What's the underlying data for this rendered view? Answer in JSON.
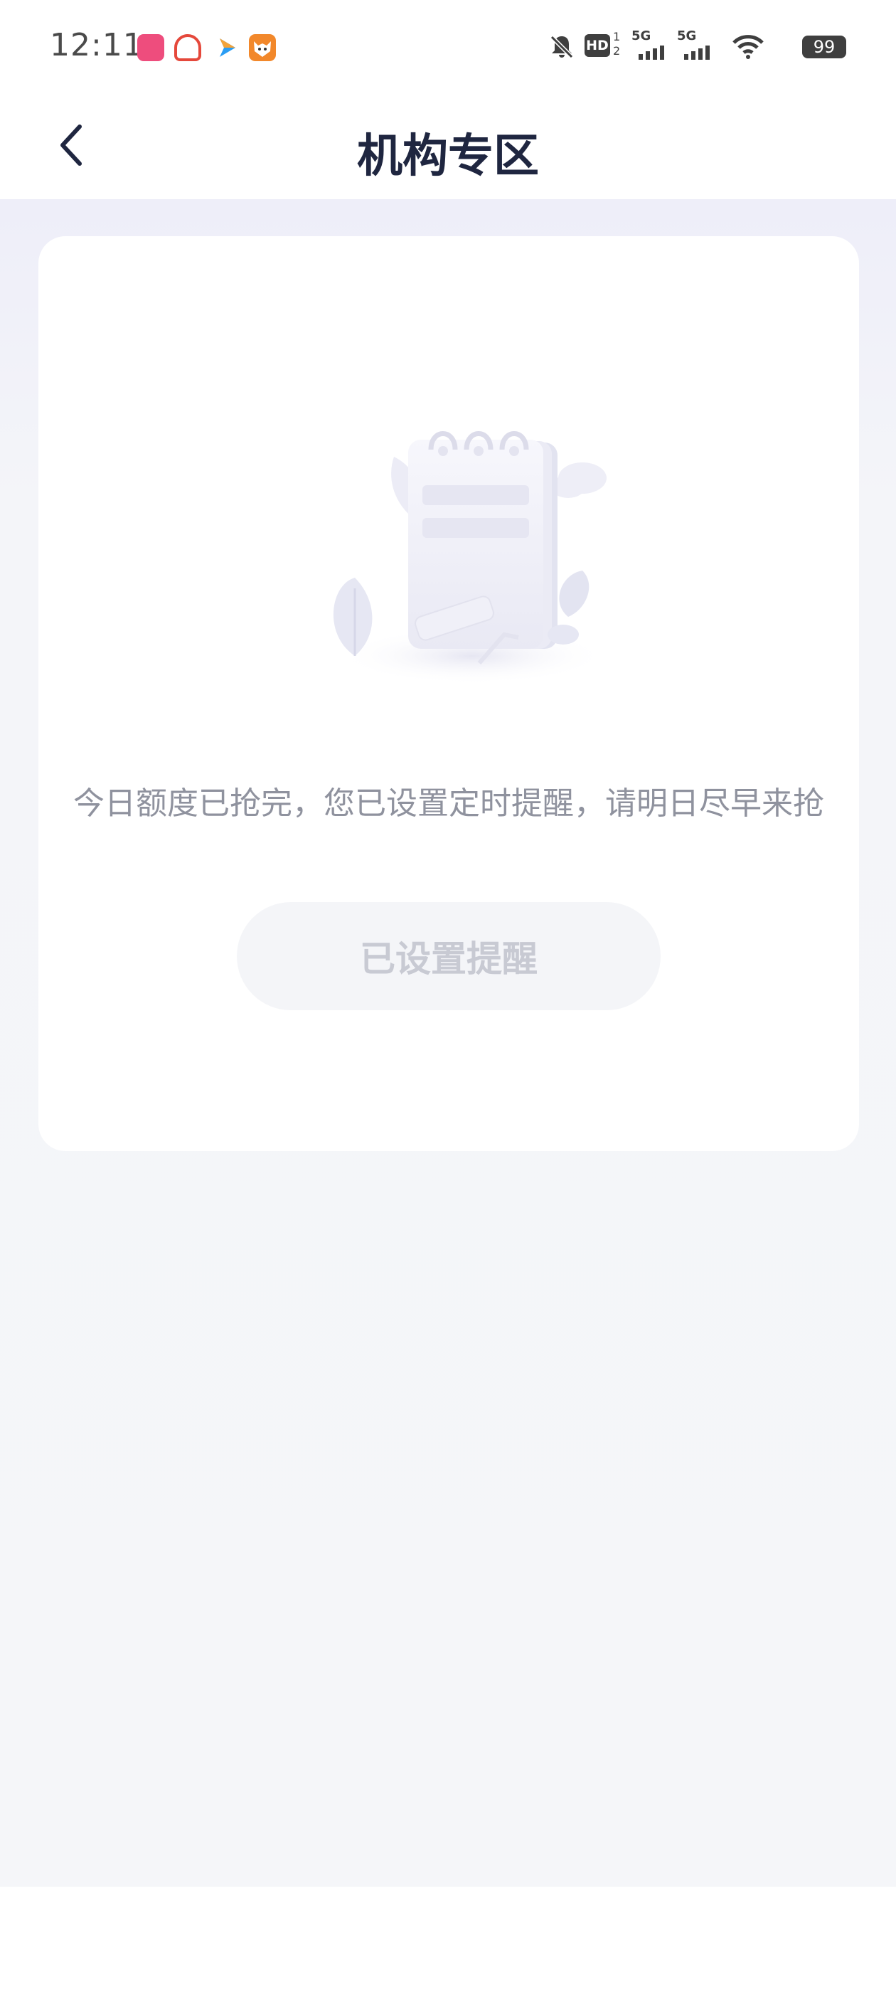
{
  "status_bar": {
    "time": "12:11",
    "battery": "99",
    "icons": [
      "app-icon-pink",
      "app-icon-red",
      "app-icon-arrow",
      "app-icon-fox",
      "bell-mute-icon",
      "hd-icon",
      "signal-5g-icon",
      "signal-5g-icon",
      "wifi-icon",
      "battery-icon"
    ],
    "hd_label": "HD",
    "net_label_1": "5G",
    "net_label_2": "5G"
  },
  "header": {
    "title": "机构专区",
    "back_icon": "chevron-left-icon"
  },
  "card": {
    "illustration": "empty-notebook-illustration",
    "message": "今日额度已抢完，您已设置定时提醒，请明日尽早来抢",
    "button_label": "已设置提醒"
  },
  "colors": {
    "title": "#1f2640",
    "message": "#8f929e",
    "button_bg": "#f4f5f8",
    "button_text": "#c8cad3",
    "page_bg": "#f4f5f9"
  }
}
